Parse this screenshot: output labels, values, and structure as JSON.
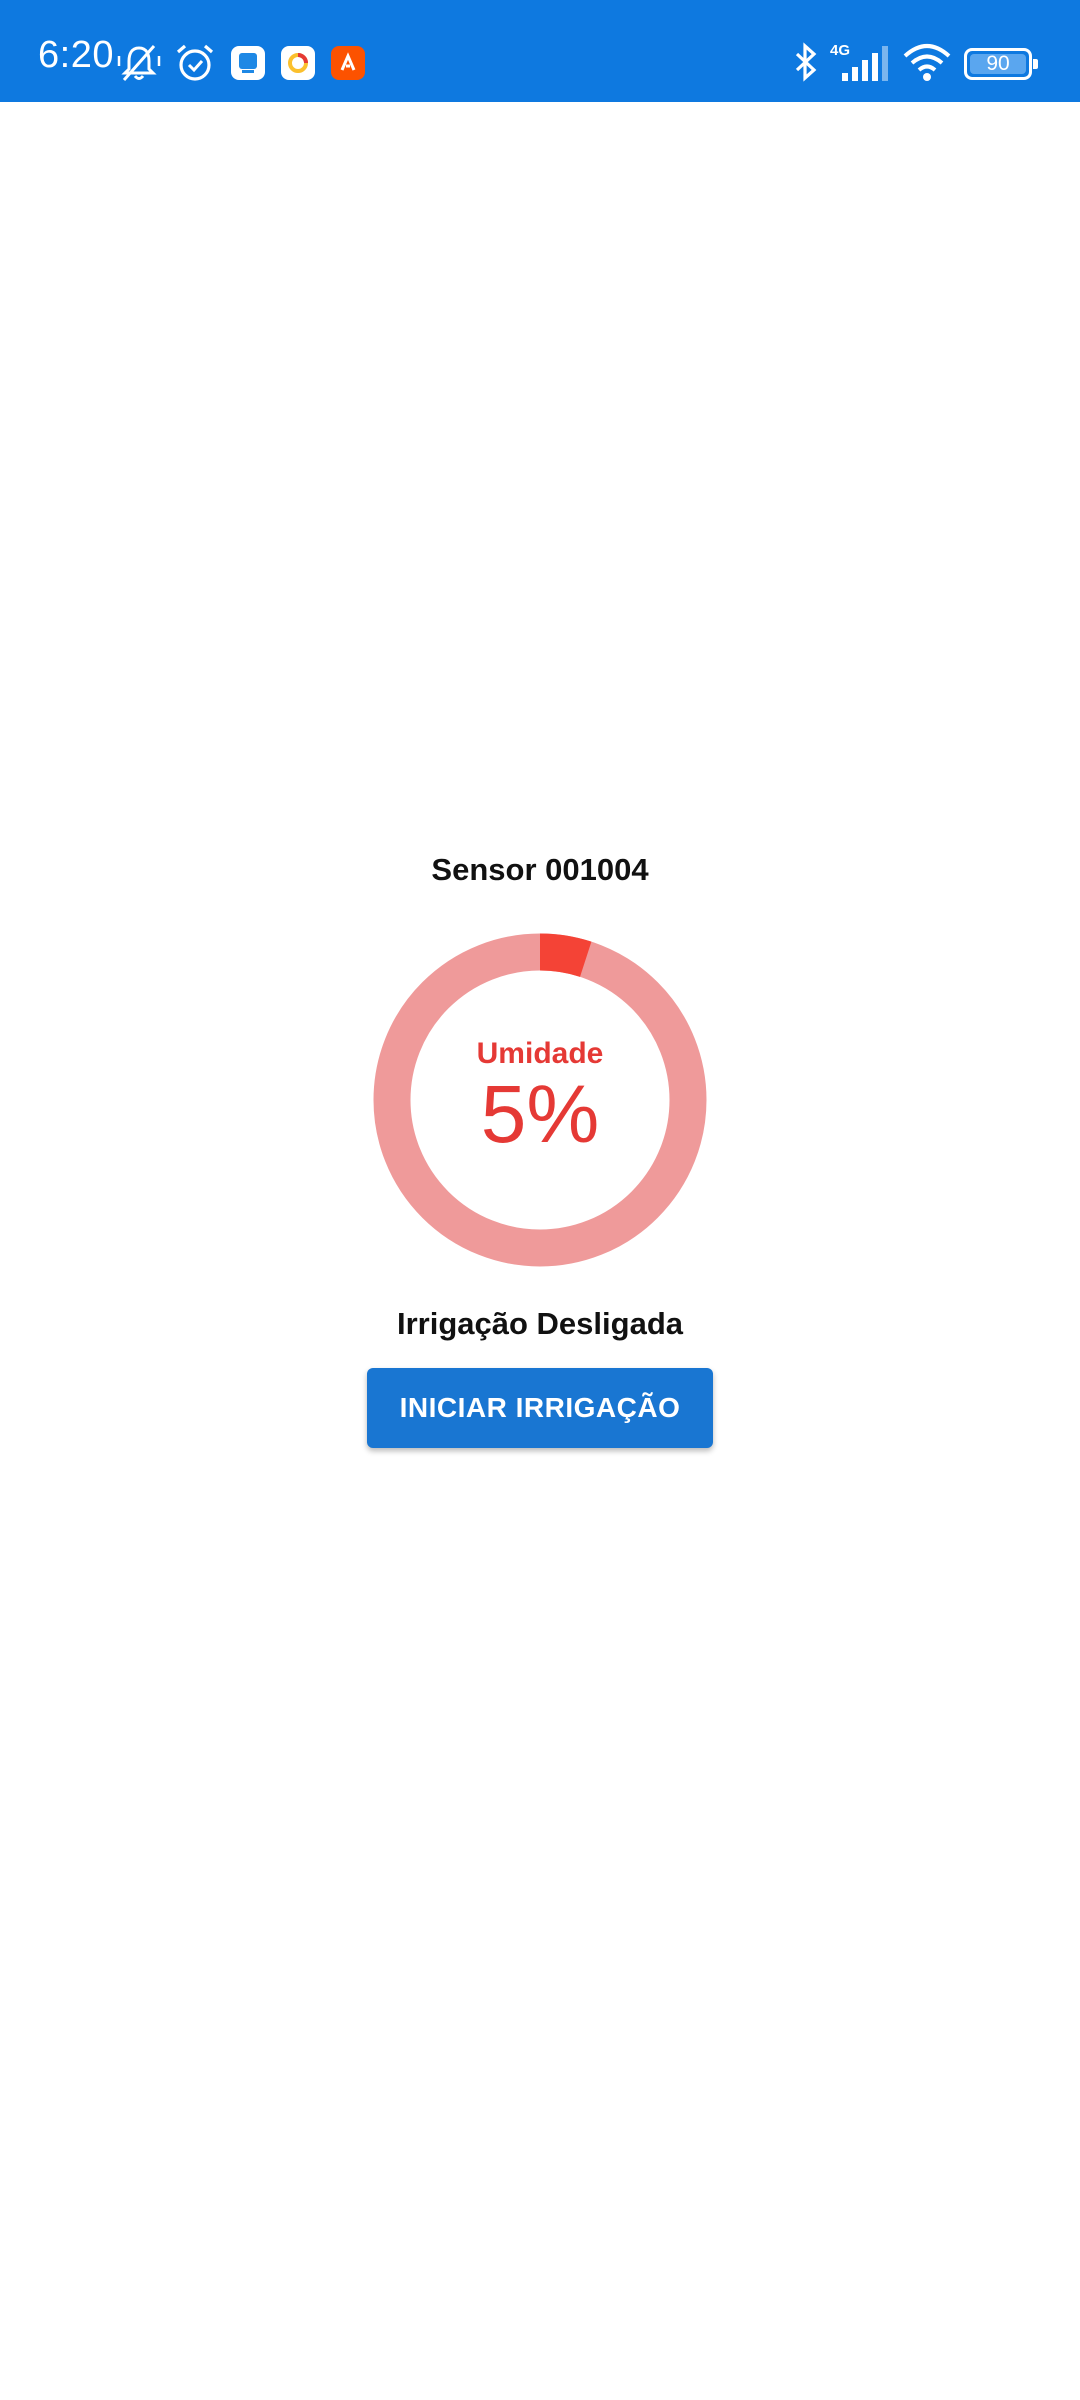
{
  "status_bar": {
    "time": "6:20",
    "battery_level": "90",
    "network_type": "4G",
    "icons": [
      "bell-muted-icon",
      "alarm-clock-icon",
      "app-notification-icon",
      "app-notification-icon",
      "app-notification-icon",
      "bluetooth-icon",
      "cellular-signal-icon",
      "wifi-icon",
      "battery-icon"
    ],
    "background_color": "#0e79e0"
  },
  "sensor": {
    "title": "Sensor 001004"
  },
  "gauge": {
    "label": "Umidade",
    "value_text": "5%",
    "value_fraction": 0.05,
    "track_color": "#ef9a9a",
    "fill_color": "#f44336",
    "text_color": "#e53935"
  },
  "irrigation": {
    "status": "Irrigação Desligada",
    "button_label": "INICIAR IRRIGAÇÃO",
    "button_color": "#1976d2"
  }
}
